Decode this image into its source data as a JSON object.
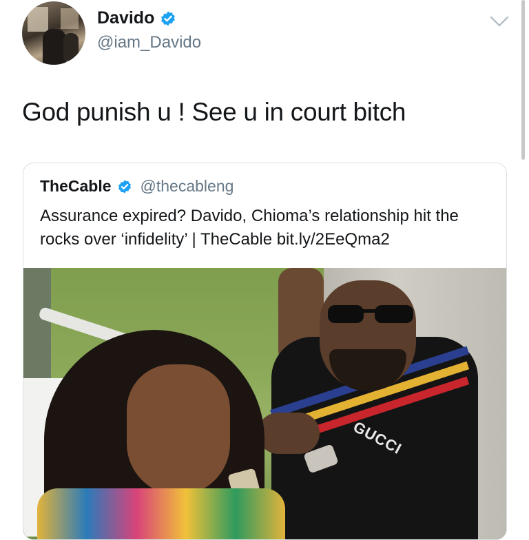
{
  "tweet": {
    "author_name": "Davido",
    "author_handle": "@iam_Davido",
    "text": "God punish u ! See u in court bitch"
  },
  "quoted_tweet": {
    "author_name": "TheCable",
    "author_handle": "@thecableng",
    "text": "Assurance expired? Davido, Chioma’s relationship hit the rocks over ‘infidelity’ | TheCable bit.ly/2EeQma2",
    "image": {
      "shirt_text": "GUCCI"
    }
  },
  "icons": {
    "verified": "verified-badge-icon",
    "menu": "chevron-down-icon"
  },
  "colors": {
    "verified_blue": "#1da1f2",
    "text_primary": "#14171a",
    "text_secondary": "#657786",
    "border": "#dadfe3"
  }
}
